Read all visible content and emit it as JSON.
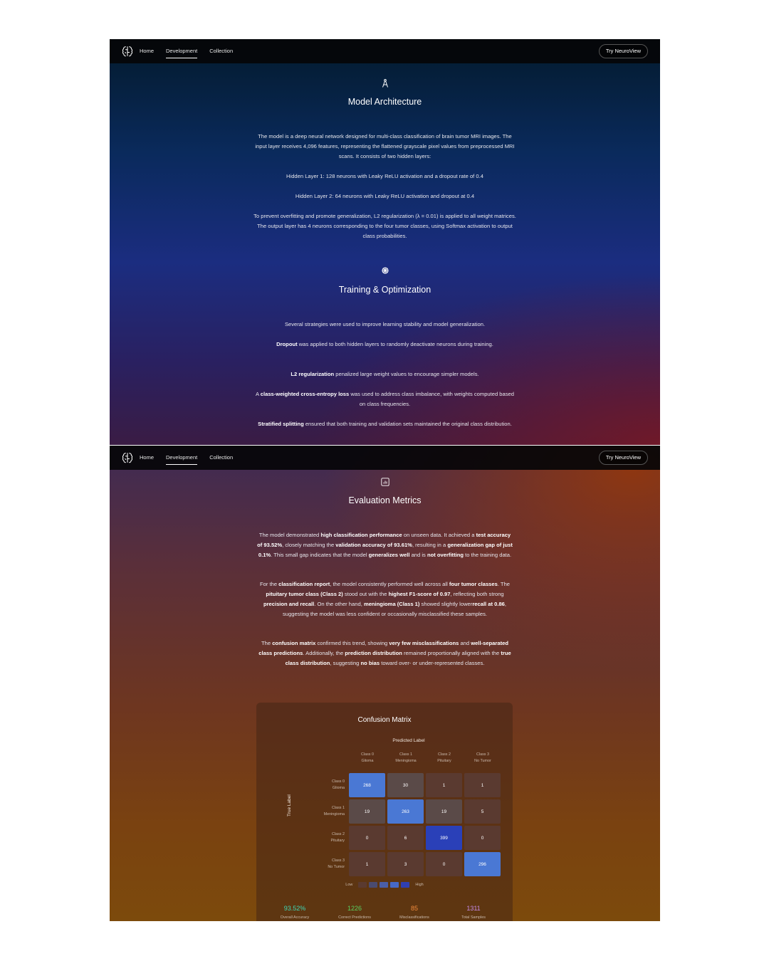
{
  "nav": {
    "home": "Home",
    "development": "Development",
    "collection": "Collection",
    "cta": "Try NeuroView"
  },
  "architecture": {
    "title": "Model Architecture",
    "p1": "The model is a deep neural network designed for multi-class classification of brain tumor MRI images. The input layer receives 4,096 features, representing the flattened grayscale pixel values from preprocessed MRI scans. It consists of two hidden layers:",
    "p2": "Hidden Layer 1: 128 neurons with Leaky ReLU activation and a dropout rate of 0.4",
    "p3": "Hidden Layer 2: 64 neurons with Leaky ReLU activation and dropout at 0.4",
    "p4": "To prevent overfitting and promote generalization, L2 regularization (λ = 0.01) is applied to all weight matrices. The output layer has 4 neurons corresponding to the four tumor classes, using Softmax activation to output class probabilities."
  },
  "training": {
    "title": "Training & Optimization",
    "intro": "Several strategies were used to improve learning stability and model generalization.",
    "dropout_b": "Dropout",
    "dropout_t": " was applied to both hidden layers to randomly deactivate neurons during training.",
    "l2_b": "L2 regularization",
    "l2_t": " penalized large weight values to encourage simpler models.",
    "ce_pre": "A ",
    "ce_b": "class-weighted cross-entropy loss",
    "ce_t": " was used to address class imbalance, with weights computed based on class frequencies.",
    "strat_b": "Stratified splitting",
    "strat_t": " ensured that both training and validation sets maintained the original class distribution."
  },
  "evaluation": {
    "title": "Evaluation Metrics",
    "a1": "The model demonstrated ",
    "a2": "high classification performance",
    "a3": " on unseen data. It achieved a ",
    "a4": "test accuracy of 93.52%",
    "a5": ", closely matching the ",
    "a6": "validation accuracy of 93.61%",
    "a7": ", resulting in a ",
    "a8": "generalization gap of just 0.1%",
    "a9": ". This small gap indicates that the model ",
    "a10": "generalizes well",
    "a11": " and is ",
    "a12": "not overfitting",
    "a13": " to the training data.",
    "b1": "For the ",
    "b2": "classification report",
    "b3": ", the model consistently performed well across all ",
    "b4": "four tumor classes",
    "b5": ". The ",
    "b6": "pituitary tumor class (Class 2)",
    "b7": " stood out with the ",
    "b8": "highest F1-score of 0.97",
    "b9": ", reflecting both strong ",
    "b10": "precision and recall",
    "b11": ". On the other hand, ",
    "b12": "meningioma (Class 1)",
    "b13": " showed slightly lower",
    "b14": "recall at 0.86",
    "b15": ", suggesting the model was less confident or occasionally misclassified these samples.",
    "c1": "The ",
    "c2": "confusion matrix",
    "c3": " confirmed this trend, showing ",
    "c4": "very few misclassifications",
    "c5": " and ",
    "c6": "well-separated class predictions",
    "c7": ". Additionally, the ",
    "c8": "prediction distribution",
    "c9": " remained proportionally aligned with the ",
    "c10": "true class distribution",
    "c11": ", suggesting ",
    "c12": "no bias",
    "c13": " toward over- or under-represented classes."
  },
  "chart_data": {
    "type": "heatmap",
    "title": "Confusion Matrix",
    "xlabel": "Predicted Label",
    "ylabel": "True Label",
    "col_labels": [
      [
        "Class 0",
        "Glioma"
      ],
      [
        "Class 1",
        "Meningioma"
      ],
      [
        "Class 2",
        "Pituitary"
      ],
      [
        "Class 3",
        "No Tumor"
      ]
    ],
    "row_labels": [
      [
        "Class 0",
        "Glioma"
      ],
      [
        "Class 1",
        "Meningioma"
      ],
      [
        "Class 2",
        "Pituitary"
      ],
      [
        "Class 3",
        "No Tumor"
      ]
    ],
    "matrix": [
      [
        268,
        30,
        1,
        1
      ],
      [
        19,
        263,
        19,
        5
      ],
      [
        0,
        6,
        399,
        0
      ],
      [
        1,
        3,
        0,
        296
      ]
    ],
    "legend_low": "Low",
    "legend_high": "High",
    "legend_colors": [
      "#5a3a30",
      "#4a4b70",
      "#4a5ea8",
      "#4669c8",
      "#2f3fb0"
    ],
    "cell_colors": {
      "diag": "#4a78d4",
      "diag_max": "#2a40b8",
      "mid": "#5a4a48",
      "base": "#5a3a30"
    }
  },
  "stats": [
    {
      "value": "93.52%",
      "label": "Overall Accuracy",
      "color": "#3fd6b4"
    },
    {
      "value": "1226",
      "label": "Correct Predictions",
      "color": "#59d160"
    },
    {
      "value": "85",
      "label": "Misclassifications",
      "color": "#f08a3c"
    },
    {
      "value": "1311",
      "label": "Total Samples",
      "color": "#c58ae8"
    }
  ]
}
